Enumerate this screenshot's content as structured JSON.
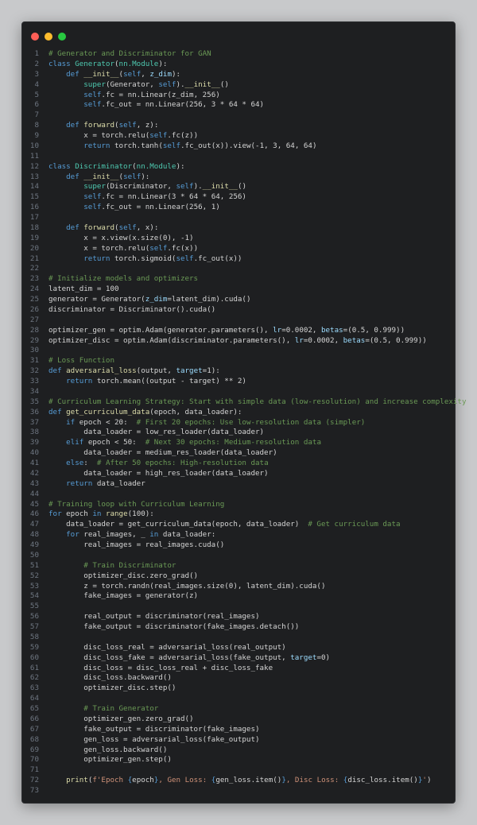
{
  "window": {
    "buttons": {
      "close": "close",
      "minimize": "minimize",
      "maximize": "maximize"
    }
  },
  "colors": {
    "background": "#c8c9cb",
    "editor": "#1e1f21",
    "comment": "#6a9955",
    "keyword": "#569cd6",
    "function": "#dcdcaa",
    "class": "#4ec9b0",
    "param": "#9cdcfe",
    "string": "#ce9178",
    "number": "#b5cea8",
    "text": "#d4d4d4"
  },
  "code_lines": [
    [
      [
        "c",
        "# Generator and Discriminator for GAN"
      ]
    ],
    [
      [
        "k",
        "class "
      ],
      [
        "cl",
        "Generator"
      ],
      [
        "p",
        "("
      ],
      [
        "cl",
        "nn.Module"
      ],
      [
        "p",
        "):"
      ]
    ],
    [
      [
        "p",
        "    "
      ],
      [
        "k",
        "def "
      ],
      [
        "f",
        "__init__"
      ],
      [
        "p",
        "("
      ],
      [
        "s",
        "self"
      ],
      [
        "p",
        ", "
      ],
      [
        "pa",
        "z_dim"
      ],
      [
        "p",
        "):"
      ]
    ],
    [
      [
        "p",
        "        "
      ],
      [
        "cl",
        "super"
      ],
      [
        "p",
        "(Generator, "
      ],
      [
        "s",
        "self"
      ],
      [
        "p",
        ")."
      ],
      [
        "f",
        "__init__"
      ],
      [
        "p",
        "()"
      ]
    ],
    [
      [
        "p",
        "        "
      ],
      [
        "s",
        "self"
      ],
      [
        "p",
        ".fc = nn.Linear(z_dim, 256)"
      ]
    ],
    [
      [
        "p",
        "        "
      ],
      [
        "s",
        "self"
      ],
      [
        "p",
        ".fc_out = nn.Linear(256, 3 * 64 * 64)"
      ]
    ],
    [
      [
        "p",
        ""
      ]
    ],
    [
      [
        "p",
        "    "
      ],
      [
        "k",
        "def "
      ],
      [
        "f",
        "forward"
      ],
      [
        "p",
        "("
      ],
      [
        "s",
        "self"
      ],
      [
        "p",
        ", z):"
      ]
    ],
    [
      [
        "p",
        "        x = torch.relu("
      ],
      [
        "s",
        "self"
      ],
      [
        "p",
        ".fc(z))"
      ]
    ],
    [
      [
        "p",
        "        "
      ],
      [
        "k",
        "return "
      ],
      [
        "p",
        "torch.tanh("
      ],
      [
        "s",
        "self"
      ],
      [
        "p",
        ".fc_out(x)).view(-1, 3, 64, 64)"
      ]
    ],
    [
      [
        "p",
        ""
      ]
    ],
    [
      [
        "k",
        "class "
      ],
      [
        "cl",
        "Discriminator"
      ],
      [
        "p",
        "("
      ],
      [
        "cl",
        "nn.Module"
      ],
      [
        "p",
        "):"
      ]
    ],
    [
      [
        "p",
        "    "
      ],
      [
        "k",
        "def "
      ],
      [
        "f",
        "__init__"
      ],
      [
        "p",
        "("
      ],
      [
        "s",
        "self"
      ],
      [
        "p",
        "):"
      ]
    ],
    [
      [
        "p",
        "        "
      ],
      [
        "cl",
        "super"
      ],
      [
        "p",
        "(Discriminator, "
      ],
      [
        "s",
        "self"
      ],
      [
        "p",
        ")."
      ],
      [
        "f",
        "__init__"
      ],
      [
        "p",
        "()"
      ]
    ],
    [
      [
        "p",
        "        "
      ],
      [
        "s",
        "self"
      ],
      [
        "p",
        ".fc = nn.Linear(3 * 64 * 64, 256)"
      ]
    ],
    [
      [
        "p",
        "        "
      ],
      [
        "s",
        "self"
      ],
      [
        "p",
        ".fc_out = nn.Linear(256, 1)"
      ]
    ],
    [
      [
        "p",
        ""
      ]
    ],
    [
      [
        "p",
        "    "
      ],
      [
        "k",
        "def "
      ],
      [
        "f",
        "forward"
      ],
      [
        "p",
        "("
      ],
      [
        "s",
        "self"
      ],
      [
        "p",
        ", x):"
      ]
    ],
    [
      [
        "p",
        "        x = x.view(x.size(0), -1)"
      ]
    ],
    [
      [
        "p",
        "        x = torch.relu("
      ],
      [
        "s",
        "self"
      ],
      [
        "p",
        ".fc(x))"
      ]
    ],
    [
      [
        "p",
        "        "
      ],
      [
        "k",
        "return "
      ],
      [
        "p",
        "torch.sigmoid("
      ],
      [
        "s",
        "self"
      ],
      [
        "p",
        ".fc_out(x))"
      ]
    ],
    [
      [
        "p",
        ""
      ]
    ],
    [
      [
        "c",
        "# Initialize models and optimizers"
      ]
    ],
    [
      [
        "p",
        "latent_dim = 100"
      ]
    ],
    [
      [
        "p",
        "generator = Generator("
      ],
      [
        "pa",
        "z_dim"
      ],
      [
        "p",
        "=latent_dim).cuda()"
      ]
    ],
    [
      [
        "p",
        "discriminator = Discriminator().cuda()"
      ]
    ],
    [
      [
        "p",
        ""
      ]
    ],
    [
      [
        "p",
        "optimizer_gen = optim.Adam(generator.parameters(), "
      ],
      [
        "pa",
        "lr"
      ],
      [
        "p",
        "=0.0002, "
      ],
      [
        "pa",
        "betas"
      ],
      [
        "p",
        "=(0.5, 0.999))"
      ]
    ],
    [
      [
        "p",
        "optimizer_disc = optim.Adam(discriminator.parameters(), "
      ],
      [
        "pa",
        "lr"
      ],
      [
        "p",
        "=0.0002, "
      ],
      [
        "pa",
        "betas"
      ],
      [
        "p",
        "=(0.5, 0.999))"
      ]
    ],
    [
      [
        "p",
        ""
      ]
    ],
    [
      [
        "c",
        "# Loss Function"
      ]
    ],
    [
      [
        "k",
        "def "
      ],
      [
        "f",
        "adversarial_loss"
      ],
      [
        "p",
        "(output, "
      ],
      [
        "pa",
        "target"
      ],
      [
        "p",
        "=1):"
      ]
    ],
    [
      [
        "p",
        "    "
      ],
      [
        "k",
        "return "
      ],
      [
        "p",
        "torch.mean((output - target) ** 2)"
      ]
    ],
    [
      [
        "p",
        ""
      ]
    ],
    [
      [
        "c",
        "# Curriculum Learning Strategy: Start with simple data (low-resolution) and increase complexity"
      ]
    ],
    [
      [
        "k",
        "def "
      ],
      [
        "f",
        "get_curriculum_data"
      ],
      [
        "p",
        "(epoch, data_loader):"
      ]
    ],
    [
      [
        "p",
        "    "
      ],
      [
        "k",
        "if "
      ],
      [
        "p",
        "epoch < 20:  "
      ],
      [
        "c",
        "# First 20 epochs: Use low-resolution data (simpler)"
      ]
    ],
    [
      [
        "p",
        "        data_loader = low_res_loader(data_loader)"
      ]
    ],
    [
      [
        "p",
        "    "
      ],
      [
        "k",
        "elif "
      ],
      [
        "p",
        "epoch < 50:  "
      ],
      [
        "c",
        "# Next 30 epochs: Medium-resolution data"
      ]
    ],
    [
      [
        "p",
        "        data_loader = medium_res_loader(data_loader)"
      ]
    ],
    [
      [
        "p",
        "    "
      ],
      [
        "k",
        "else"
      ],
      [
        "p",
        ":  "
      ],
      [
        "c",
        "# After 50 epochs: High-resolution data"
      ]
    ],
    [
      [
        "p",
        "        data_loader = high_res_loader(data_loader)"
      ]
    ],
    [
      [
        "p",
        "    "
      ],
      [
        "k",
        "return "
      ],
      [
        "p",
        "data_loader"
      ]
    ],
    [
      [
        "p",
        ""
      ]
    ],
    [
      [
        "c",
        "# Training loop with Curriculum Learning"
      ]
    ],
    [
      [
        "k",
        "for "
      ],
      [
        "p",
        "epoch "
      ],
      [
        "k",
        "in "
      ],
      [
        "f",
        "range"
      ],
      [
        "p",
        "(100):"
      ]
    ],
    [
      [
        "p",
        "    data_loader = get_curriculum_data(epoch, data_loader)  "
      ],
      [
        "c",
        "# Get curriculum data"
      ]
    ],
    [
      [
        "p",
        "    "
      ],
      [
        "k",
        "for "
      ],
      [
        "p",
        "real_images, _ "
      ],
      [
        "k",
        "in "
      ],
      [
        "p",
        "data_loader:"
      ]
    ],
    [
      [
        "p",
        "        real_images = real_images.cuda()"
      ]
    ],
    [
      [
        "p",
        ""
      ]
    ],
    [
      [
        "p",
        "        "
      ],
      [
        "c",
        "# Train Discriminator"
      ]
    ],
    [
      [
        "p",
        "        optimizer_disc.zero_grad()"
      ]
    ],
    [
      [
        "p",
        "        z = torch.randn(real_images.size(0), latent_dim).cuda()"
      ]
    ],
    [
      [
        "p",
        "        fake_images = generator(z)"
      ]
    ],
    [
      [
        "p",
        ""
      ]
    ],
    [
      [
        "p",
        "        real_output = discriminator(real_images)"
      ]
    ],
    [
      [
        "p",
        "        fake_output = discriminator(fake_images.detach())"
      ]
    ],
    [
      [
        "p",
        ""
      ]
    ],
    [
      [
        "p",
        "        disc_loss_real = adversarial_loss(real_output)"
      ]
    ],
    [
      [
        "p",
        "        disc_loss_fake = adversarial_loss(fake_output, "
      ],
      [
        "pa",
        "target"
      ],
      [
        "p",
        "=0)"
      ]
    ],
    [
      [
        "p",
        "        disc_loss = disc_loss_real + disc_loss_fake"
      ]
    ],
    [
      [
        "p",
        "        disc_loss.backward()"
      ]
    ],
    [
      [
        "p",
        "        optimizer_disc.step()"
      ]
    ],
    [
      [
        "p",
        ""
      ]
    ],
    [
      [
        "p",
        "        "
      ],
      [
        "c",
        "# Train Generator"
      ]
    ],
    [
      [
        "p",
        "        optimizer_gen.zero_grad()"
      ]
    ],
    [
      [
        "p",
        "        fake_output = discriminator(fake_images)"
      ]
    ],
    [
      [
        "p",
        "        gen_loss = adversarial_loss(fake_output)"
      ]
    ],
    [
      [
        "p",
        "        gen_loss.backward()"
      ]
    ],
    [
      [
        "p",
        "        optimizer_gen.step()"
      ]
    ],
    [
      [
        "p",
        ""
      ]
    ],
    [
      [
        "p",
        "    "
      ],
      [
        "f",
        "print"
      ],
      [
        "p",
        "("
      ],
      [
        "st",
        "f'Epoch "
      ],
      [
        "k",
        "{"
      ],
      [
        "p",
        "epoch"
      ],
      [
        "k",
        "}"
      ],
      [
        "st",
        ", Gen Loss: "
      ],
      [
        "k",
        "{"
      ],
      [
        "p",
        "gen_loss.item()"
      ],
      [
        "k",
        "}"
      ],
      [
        "st",
        ", Disc Loss: "
      ],
      [
        "k",
        "{"
      ],
      [
        "p",
        "disc_loss.item()"
      ],
      [
        "k",
        "}"
      ],
      [
        "st",
        "'"
      ],
      [
        "p",
        ")"
      ]
    ],
    [
      [
        "p",
        ""
      ]
    ]
  ]
}
